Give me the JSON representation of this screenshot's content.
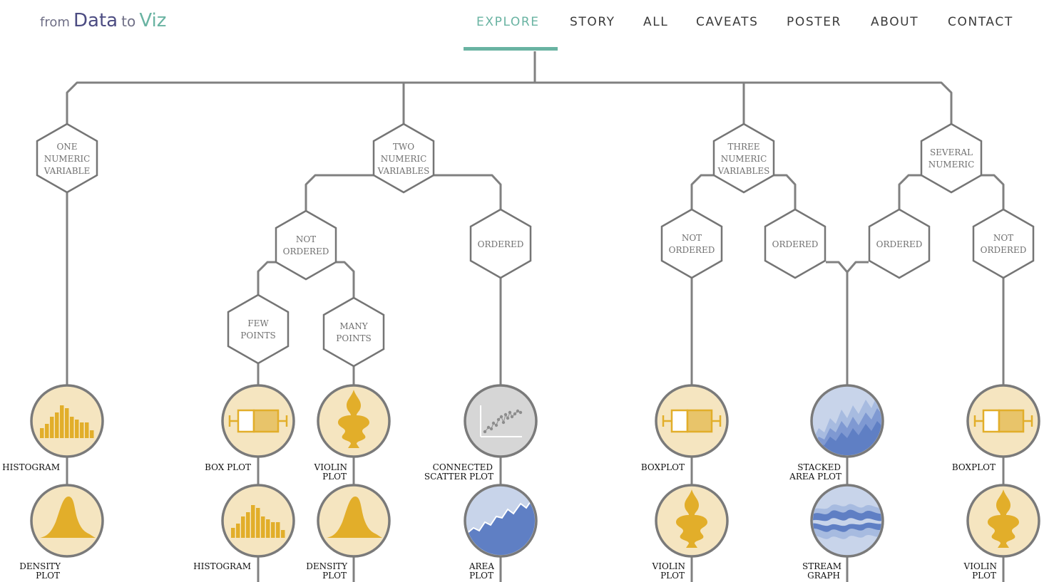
{
  "logo": {
    "part1": "from",
    "part2": "Data",
    "part3": "to",
    "part4": "Viz"
  },
  "nav": [
    {
      "label": "EXPLORE",
      "active": true
    },
    {
      "label": "STORY",
      "active": false
    },
    {
      "label": "ALL",
      "active": false
    },
    {
      "label": "CAVEATS",
      "active": false
    },
    {
      "label": "POSTER",
      "active": false
    },
    {
      "label": "ABOUT",
      "active": false
    },
    {
      "label": "CONTACT",
      "active": false
    }
  ],
  "colors": {
    "accent": "#69b3a2",
    "line": "#808080",
    "hex_stroke": "#757575",
    "yellow_fill": "#f5e5c0",
    "yellow_mark": "#e2ae2a",
    "blue_fill": "#c8d4ea",
    "blue_mark": "#5f7fc4",
    "gray_fill": "#d6d6d6"
  },
  "categories": {
    "one": {
      "label": "ONE NUMERIC VARIABLE"
    },
    "two": {
      "label": "TWO NUMERIC VARIABLES",
      "not_ordered": "NOT ORDERED",
      "few_points": "FEW POINTS",
      "many_points": "MANY POINTS",
      "ordered": "ORDERED"
    },
    "three": {
      "label": "THREE NUMERIC VARIABLES",
      "not_ordered": "NOT ORDERED",
      "ordered": "ORDERED"
    },
    "several": {
      "label": "SEVERAL NUMERIC",
      "ordered": "ORDERED",
      "not_ordered": "NOT ORDERED"
    }
  },
  "charts": {
    "histogram_1": "HISTOGRAM",
    "density_1": "DENSITY PLOT",
    "boxplot_2": "BOX PLOT",
    "histogram_2": "HISTOGRAM",
    "violin_2": "VIOLIN PLOT",
    "density_2": "DENSITY PLOT",
    "connected_scatter": "CONNECTED SCATTER PLOT",
    "area": "AREA PLOT",
    "boxplot_3": "BOXPLOT",
    "violin_3": "VIOLIN PLOT",
    "stacked_area": "STACKED AREA PLOT",
    "stream": "STREAM GRAPH",
    "boxplot_4": "BOXPLOT",
    "violin_4": "VIOLIN PLOT"
  }
}
